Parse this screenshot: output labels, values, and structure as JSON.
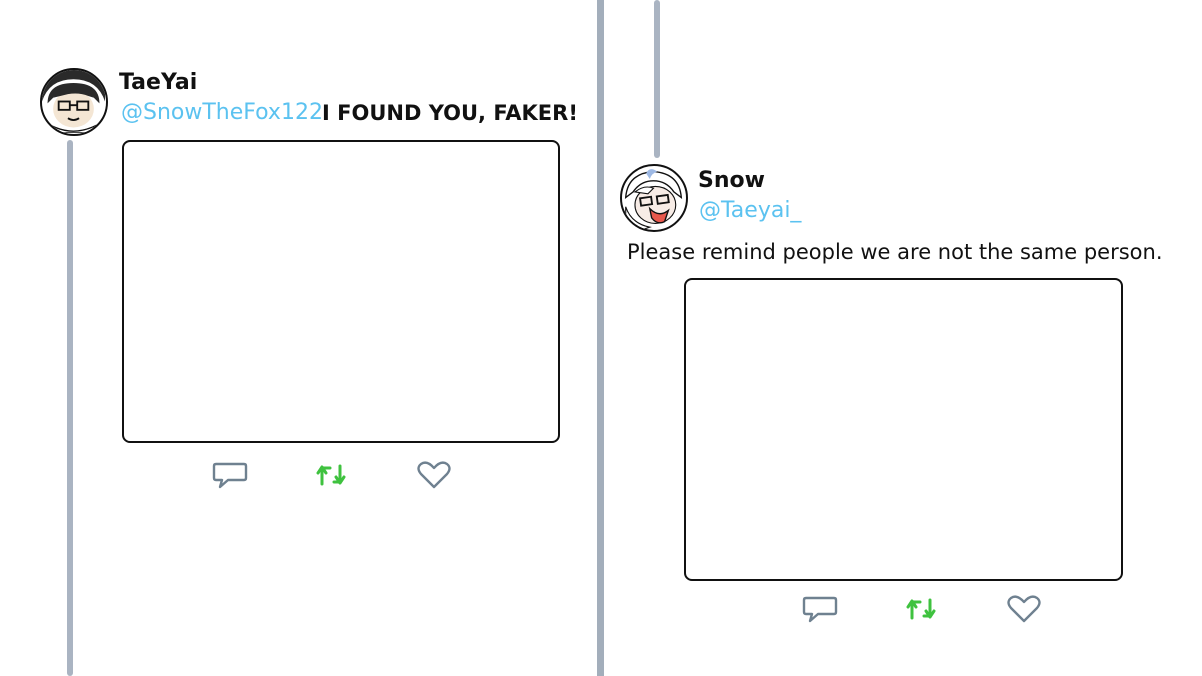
{
  "colors": {
    "handle": "#5bc2f0",
    "retweet": "#3fc23f",
    "action_outline": "#6f8190",
    "thread_line": "#aab4c2",
    "divider": "#a3aebb"
  },
  "tweets": [
    {
      "display_name": "TaeYai",
      "handle": "@SnowTheFox122",
      "text": "I FOUND YOU, FAKER!",
      "icons": {
        "reply": "reply-icon",
        "retweet": "retweet-icon",
        "like": "heart-icon"
      }
    },
    {
      "display_name": "Snow",
      "handle": "@Taeyai_",
      "text": "Please remind people we are not the same person.",
      "icons": {
        "reply": "reply-icon",
        "retweet": "retweet-icon",
        "like": "heart-icon"
      }
    }
  ]
}
